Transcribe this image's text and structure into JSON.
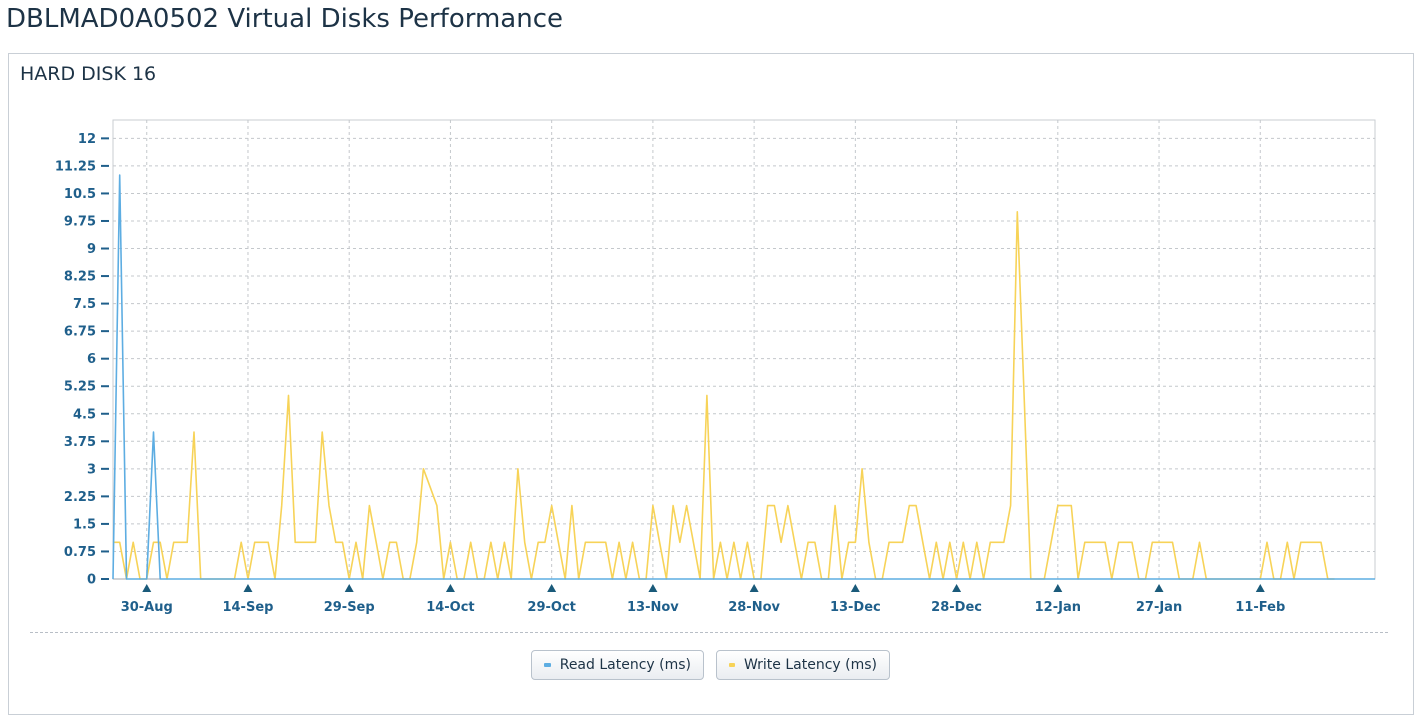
{
  "page": {
    "title": "DBLMAD0A0502 Virtual Disks Performance"
  },
  "panel": {
    "title": "HARD DISK 16"
  },
  "colors": {
    "read": "#5dade2",
    "write": "#f7d358",
    "axis_text": "#1f5f8b",
    "marker": "#1a5a7a",
    "grid": "#c4c8cc"
  },
  "legend": [
    {
      "label": "Read Latency (ms)",
      "color": "#5dade2",
      "icon": "line-swatch"
    },
    {
      "label": "Write Latency (ms)",
      "color": "#f7d358",
      "icon": "line-swatch"
    }
  ],
  "chart_data": {
    "type": "line",
    "ylim": [
      0,
      12.5
    ],
    "y_ticks": [
      0,
      0.75,
      1.5,
      2.25,
      3,
      3.75,
      4.5,
      5.25,
      6,
      6.75,
      7.5,
      8.25,
      9,
      9.75,
      10.5,
      11.25,
      12
    ],
    "y_tick_labels": [
      "0",
      "0.75",
      "1.5",
      "2.25",
      "3",
      "3.75",
      "4.5",
      "5.25",
      "6",
      "6.75",
      "7.5",
      "8.25",
      "9",
      "9.75",
      "10.5",
      "11.25",
      "12"
    ],
    "x_start": "2023-08-25",
    "x_end": "2024-02-28",
    "x_tick_dates": [
      "2023-08-30",
      "2023-09-14",
      "2023-09-29",
      "2023-10-14",
      "2023-10-29",
      "2023-11-13",
      "2023-11-28",
      "2023-12-13",
      "2023-12-28",
      "2024-01-12",
      "2024-01-27",
      "2024-02-11"
    ],
    "x_tick_labels": [
      "30-Aug",
      "14-Sep",
      "29-Sep",
      "14-Oct",
      "29-Oct",
      "13-Nov",
      "28-Nov",
      "13-Dec",
      "28-Dec",
      "12-Jan",
      "27-Jan",
      "11-Feb"
    ],
    "grid": true,
    "legend_position": "bottom-center",
    "series": [
      {
        "name": "Read Latency (ms)",
        "points": [
          [
            "2023-08-25",
            0
          ],
          [
            "2023-08-26",
            11
          ],
          [
            "2023-08-27",
            0
          ],
          [
            "2023-08-30",
            0
          ],
          [
            "2023-08-31",
            4
          ],
          [
            "2023-09-01",
            0
          ],
          [
            "2024-02-28",
            0
          ]
        ]
      },
      {
        "name": "Write Latency (ms)",
        "points": [
          [
            "2023-08-25",
            1
          ],
          [
            "2023-08-26",
            1
          ],
          [
            "2023-08-27",
            0
          ],
          [
            "2023-08-28",
            1
          ],
          [
            "2023-08-29",
            0
          ],
          [
            "2023-08-30",
            0
          ],
          [
            "2023-08-31",
            1
          ],
          [
            "2023-09-01",
            1
          ],
          [
            "2023-09-02",
            0
          ],
          [
            "2023-09-03",
            1
          ],
          [
            "2023-09-04",
            1
          ],
          [
            "2023-09-05",
            1
          ],
          [
            "2023-09-06",
            4
          ],
          [
            "2023-09-07",
            0
          ],
          [
            "2023-09-08",
            0
          ],
          [
            "2023-09-09",
            0
          ],
          [
            "2023-09-10",
            0
          ],
          [
            "2023-09-11",
            0
          ],
          [
            "2023-09-12",
            0
          ],
          [
            "2023-09-13",
            1
          ],
          [
            "2023-09-14",
            0
          ],
          [
            "2023-09-15",
            1
          ],
          [
            "2023-09-16",
            1
          ],
          [
            "2023-09-17",
            1
          ],
          [
            "2023-09-18",
            0
          ],
          [
            "2023-09-19",
            2
          ],
          [
            "2023-09-20",
            5
          ],
          [
            "2023-09-21",
            1
          ],
          [
            "2023-09-22",
            1
          ],
          [
            "2023-09-23",
            1
          ],
          [
            "2023-09-24",
            1
          ],
          [
            "2023-09-25",
            4
          ],
          [
            "2023-09-26",
            2
          ],
          [
            "2023-09-27",
            1
          ],
          [
            "2023-09-28",
            1
          ],
          [
            "2023-09-29",
            0
          ],
          [
            "2023-09-30",
            1
          ],
          [
            "2023-10-01",
            0
          ],
          [
            "2023-10-02",
            2
          ],
          [
            "2023-10-03",
            1
          ],
          [
            "2023-10-04",
            0
          ],
          [
            "2023-10-05",
            1
          ],
          [
            "2023-10-06",
            1
          ],
          [
            "2023-10-07",
            0
          ],
          [
            "2023-10-08",
            0
          ],
          [
            "2023-10-09",
            1
          ],
          [
            "2023-10-10",
            3
          ],
          [
            "2023-10-11",
            2.5
          ],
          [
            "2023-10-12",
            2
          ],
          [
            "2023-10-13",
            0
          ],
          [
            "2023-10-14",
            1
          ],
          [
            "2023-10-15",
            0
          ],
          [
            "2023-10-16",
            0
          ],
          [
            "2023-10-17",
            1
          ],
          [
            "2023-10-18",
            0
          ],
          [
            "2023-10-19",
            0
          ],
          [
            "2023-10-20",
            1
          ],
          [
            "2023-10-21",
            0
          ],
          [
            "2023-10-22",
            1
          ],
          [
            "2023-10-23",
            0
          ],
          [
            "2023-10-24",
            3
          ],
          [
            "2023-10-25",
            1
          ],
          [
            "2023-10-26",
            0
          ],
          [
            "2023-10-27",
            1
          ],
          [
            "2023-10-28",
            1
          ],
          [
            "2023-10-29",
            2
          ],
          [
            "2023-10-30",
            1
          ],
          [
            "2023-10-31",
            0
          ],
          [
            "2023-11-01",
            2
          ],
          [
            "2023-11-02",
            0
          ],
          [
            "2023-11-03",
            1
          ],
          [
            "2023-11-04",
            1
          ],
          [
            "2023-11-05",
            1
          ],
          [
            "2023-11-06",
            1
          ],
          [
            "2023-11-07",
            0
          ],
          [
            "2023-11-08",
            1
          ],
          [
            "2023-11-09",
            0
          ],
          [
            "2023-11-10",
            1
          ],
          [
            "2023-11-11",
            0
          ],
          [
            "2023-11-12",
            0
          ],
          [
            "2023-11-13",
            2
          ],
          [
            "2023-11-14",
            1
          ],
          [
            "2023-11-15",
            0
          ],
          [
            "2023-11-16",
            2
          ],
          [
            "2023-11-17",
            1
          ],
          [
            "2023-11-18",
            2
          ],
          [
            "2023-11-19",
            1
          ],
          [
            "2023-11-20",
            0
          ],
          [
            "2023-11-21",
            5
          ],
          [
            "2023-11-22",
            0
          ],
          [
            "2023-11-23",
            1
          ],
          [
            "2023-11-24",
            0
          ],
          [
            "2023-11-25",
            1
          ],
          [
            "2023-11-26",
            0
          ],
          [
            "2023-11-27",
            1
          ],
          [
            "2023-11-28",
            0
          ],
          [
            "2023-11-29",
            0
          ],
          [
            "2023-11-30",
            2
          ],
          [
            "2023-12-01",
            2
          ],
          [
            "2023-12-02",
            1
          ],
          [
            "2023-12-03",
            2
          ],
          [
            "2023-12-04",
            1
          ],
          [
            "2023-12-05",
            0
          ],
          [
            "2023-12-06",
            1
          ],
          [
            "2023-12-07",
            1
          ],
          [
            "2023-12-08",
            0
          ],
          [
            "2023-12-09",
            0
          ],
          [
            "2023-12-10",
            2
          ],
          [
            "2023-12-11",
            0
          ],
          [
            "2023-12-12",
            1
          ],
          [
            "2023-12-13",
            1
          ],
          [
            "2023-12-14",
            3
          ],
          [
            "2023-12-15",
            1
          ],
          [
            "2023-12-16",
            0
          ],
          [
            "2023-12-17",
            0
          ],
          [
            "2023-12-18",
            1
          ],
          [
            "2023-12-19",
            1
          ],
          [
            "2023-12-20",
            1
          ],
          [
            "2023-12-21",
            2
          ],
          [
            "2023-12-22",
            2
          ],
          [
            "2023-12-23",
            1
          ],
          [
            "2023-12-24",
            0
          ],
          [
            "2023-12-25",
            1
          ],
          [
            "2023-12-26",
            0
          ],
          [
            "2023-12-27",
            1
          ],
          [
            "2023-12-28",
            0
          ],
          [
            "2023-12-29",
            1
          ],
          [
            "2023-12-30",
            0
          ],
          [
            "2023-12-31",
            1
          ],
          [
            "2024-01-01",
            0
          ],
          [
            "2024-01-02",
            1
          ],
          [
            "2024-01-03",
            1
          ],
          [
            "2024-01-04",
            1
          ],
          [
            "2024-01-05",
            2
          ],
          [
            "2024-01-06",
            10
          ],
          [
            "2024-01-07",
            5
          ],
          [
            "2024-01-08",
            0
          ],
          [
            "2024-01-09",
            0
          ],
          [
            "2024-01-10",
            0
          ],
          [
            "2024-01-11",
            1
          ],
          [
            "2024-01-12",
            2
          ],
          [
            "2024-01-13",
            2
          ],
          [
            "2024-01-14",
            2
          ],
          [
            "2024-01-15",
            0
          ],
          [
            "2024-01-16",
            1
          ],
          [
            "2024-01-17",
            1
          ],
          [
            "2024-01-18",
            1
          ],
          [
            "2024-01-19",
            1
          ],
          [
            "2024-01-20",
            0
          ],
          [
            "2024-01-21",
            1
          ],
          [
            "2024-01-22",
            1
          ],
          [
            "2024-01-23",
            1
          ],
          [
            "2024-01-24",
            0
          ],
          [
            "2024-01-25",
            0
          ],
          [
            "2024-01-26",
            1
          ],
          [
            "2024-01-27",
            1
          ],
          [
            "2024-01-28",
            1
          ],
          [
            "2024-01-29",
            1
          ],
          [
            "2024-01-30",
            0
          ],
          [
            "2024-01-31",
            0
          ],
          [
            "2024-02-01",
            0
          ],
          [
            "2024-02-02",
            1
          ],
          [
            "2024-02-03",
            0
          ],
          [
            "2024-02-04",
            0
          ],
          [
            "2024-02-05",
            0
          ],
          [
            "2024-02-06",
            0
          ],
          [
            "2024-02-07",
            0
          ],
          [
            "2024-02-08",
            0
          ],
          [
            "2024-02-09",
            0
          ],
          [
            "2024-02-10",
            0
          ],
          [
            "2024-02-11",
            0
          ],
          [
            "2024-02-12",
            1
          ],
          [
            "2024-02-13",
            0
          ],
          [
            "2024-02-14",
            0
          ],
          [
            "2024-02-15",
            1
          ],
          [
            "2024-02-16",
            0
          ],
          [
            "2024-02-17",
            1
          ],
          [
            "2024-02-18",
            1
          ],
          [
            "2024-02-19",
            1
          ],
          [
            "2024-02-20",
            1
          ],
          [
            "2024-02-21",
            0
          ],
          [
            "2024-02-22",
            0
          ]
        ]
      }
    ]
  }
}
